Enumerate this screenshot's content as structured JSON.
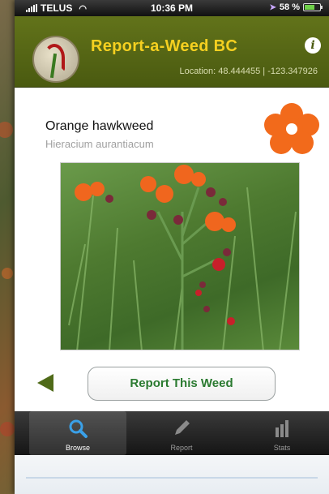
{
  "status_bar": {
    "carrier": "TELUS",
    "time": "10:36 PM",
    "battery": "58 %"
  },
  "header": {
    "title": "Report-a-Weed BC",
    "info_icon": "info-icon",
    "location": "Location: 48.444455 | -123.347926"
  },
  "weed": {
    "common_name": "Orange hawkweed",
    "latin_name": "Hieracium aurantiacum",
    "icon": "flower-icon",
    "icon_color": "#f26a1b"
  },
  "actions": {
    "report_button": "Report This Weed",
    "back_icon": "back-arrow-icon"
  },
  "tabs": [
    {
      "label": "Browse",
      "icon": "search-icon",
      "active": true
    },
    {
      "label": "Report",
      "icon": "pencil-icon",
      "active": false
    },
    {
      "label": "Stats",
      "icon": "bar-chart-icon",
      "active": false
    }
  ],
  "colors": {
    "header": "#55661a",
    "title": "#f5d020",
    "button_text": "#2a7a30"
  }
}
